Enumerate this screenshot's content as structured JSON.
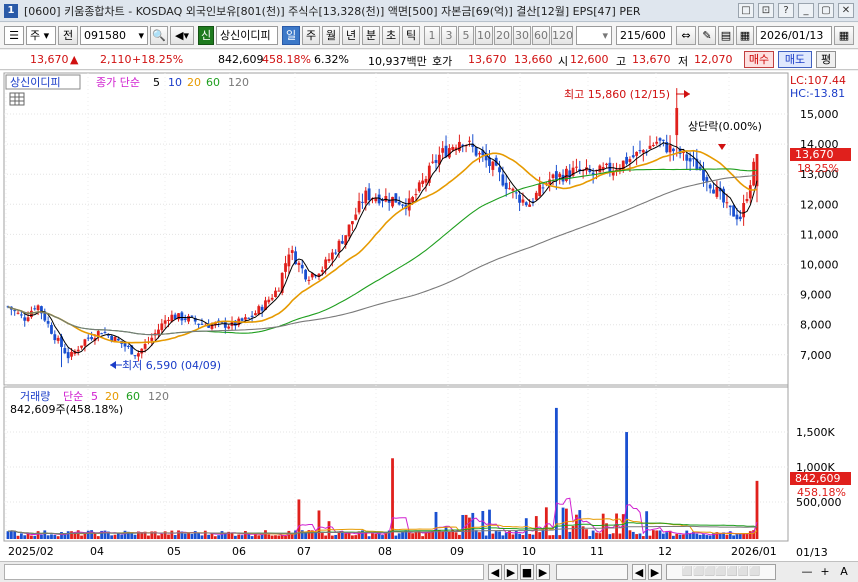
{
  "window": {
    "title": "[0600] 키움종합차트 - KOSDAQ 외국인보유[801(천)] 주식수[13,328(천)] 액면[500] 자본금[69(억)] 결산[12월] EPS[47] PER",
    "icon_label": "1",
    "buttons": [
      "□",
      "⊡",
      "?",
      "_",
      "▢",
      "✕"
    ]
  },
  "toolbar": {
    "market": "주",
    "prev": "전",
    "code": "091580",
    "shin": "신",
    "stock_name": "상신이디피",
    "period_tabs": [
      "일",
      "주",
      "월",
      "년",
      "분",
      "초",
      "틱"
    ],
    "selected_period": "일",
    "intervals": [
      "1",
      "3",
      "5",
      "10",
      "20",
      "30",
      "60",
      "120"
    ],
    "count": "215",
    "count_total": "/600",
    "date": "2026/01/13"
  },
  "quote": {
    "price": "13,670",
    "arrow": "▲",
    "change": "2,110",
    "change_pct": "+18.25%",
    "volume": "842,609",
    "vol_ratio": "458.18%",
    "turnover": "6.32%",
    "amount": "10,937백만",
    "bid_label": "호가",
    "ask": "13,670",
    "bid": "13,660",
    "open_label": "시",
    "open": "12,600",
    "high_label": "고",
    "high": "13,670",
    "low_label": "저",
    "low": "12,070",
    "sell": "매수",
    "buy": "매도",
    "eval": "평"
  },
  "price_panel": {
    "legend_name": "상신이디피",
    "ma_label": "종가 단순",
    "ma_periods": [
      "5",
      "10",
      "20",
      "60",
      "120"
    ],
    "ma_colors": [
      "#000000",
      "#e69a00",
      "#1f9f1f",
      "#7a7a7a",
      "#7a7a7a"
    ],
    "lc": "LC:107.44",
    "hc": "HC:-13.81",
    "y_labels": [
      "15,000",
      "14,000",
      "13,000",
      "12,000",
      "11,000",
      "10,000",
      "9,000",
      "8,000",
      "7,000"
    ],
    "current_price": "13,670",
    "current_pct": "18.25%",
    "high_annot": "최고 15,860 (12/15)",
    "low_annot": "최저 6,590 (04/09)",
    "limit_annot": "상단락(0.00%)"
  },
  "volume_panel": {
    "legend_name": "거래량",
    "ma_label": "단순",
    "ma_periods": [
      "5",
      "20",
      "60",
      "120"
    ],
    "ma_colors": [
      "#d020d0",
      "#e69a00",
      "#1f9f1f",
      "#7a7a7a"
    ],
    "current_label": "842,609주(458.18%)",
    "y_labels": [
      "1,500K",
      "1,000K",
      "500,000"
    ],
    "current_value": "842,609",
    "current_pct": "458.18%"
  },
  "x_axis": {
    "labels": [
      "2025/02",
      "04",
      "05",
      "06",
      "07",
      "08",
      "09",
      "10",
      "11",
      "12",
      "2026/01"
    ],
    "right_label": "01/13"
  },
  "colors": {
    "up": "#e0201c",
    "down": "#1a50d0",
    "ma5": "#000000",
    "ma10": "#e69a00",
    "ma20": "#1f9f1f",
    "ma60": "#7a7a7a"
  },
  "bottom": {
    "controls": [
      "◀",
      "▶",
      "■",
      "▶",
      "◀",
      "▶",
      "—",
      "+",
      "A"
    ]
  }
}
